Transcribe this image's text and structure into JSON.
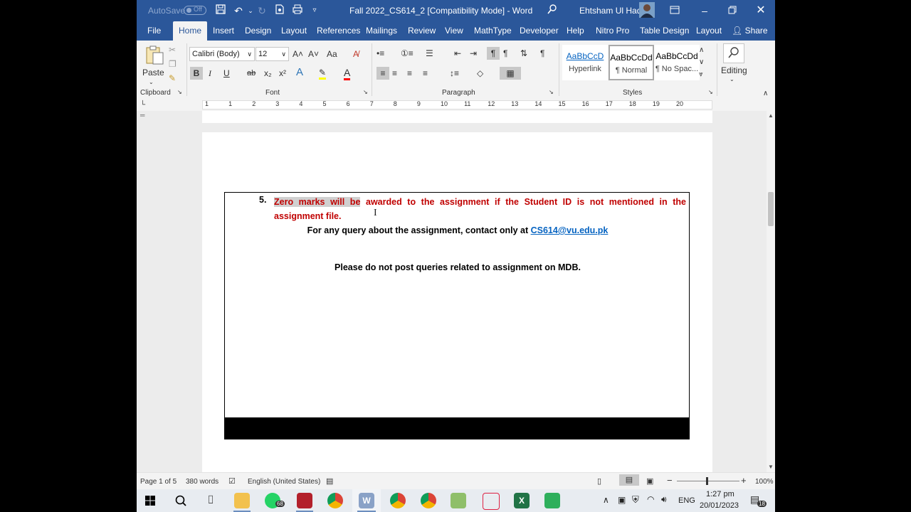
{
  "window": {
    "autosave_label": "AutoSave",
    "autosave_state": "Off",
    "doc_title": "Fall 2022_CS614_2 [Compatibility Mode]  -  Word",
    "user_name": "Ehtsham Ul Haq"
  },
  "tabs": [
    "File",
    "Home",
    "Insert",
    "Design",
    "Layout",
    "References",
    "Mailings",
    "Review",
    "View",
    "MathType",
    "Developer",
    "Help",
    "Nitro Pro",
    "Table Design",
    "Layout"
  ],
  "share_label": "Share",
  "ribbon": {
    "clipboard": {
      "paste_label": "Paste",
      "group_label": "Clipboard"
    },
    "font": {
      "name": "Calibri (Body)",
      "size": "12",
      "group_label": "Font",
      "bold": "B",
      "italic": "I",
      "underline": "U",
      "strike": "ab",
      "sub": "x₂",
      "sup": "x²",
      "case": "Aa"
    },
    "paragraph": {
      "group_label": "Paragraph"
    },
    "styles": {
      "group_label": "Styles",
      "items": [
        {
          "preview": "AaBbCcD",
          "name": "Hyperlink"
        },
        {
          "preview": "AaBbCcDd",
          "name": "¶ Normal"
        },
        {
          "preview": "AaBbCcDd",
          "name": "¶ No Spac..."
        }
      ]
    },
    "editing": {
      "label": "Editing"
    }
  },
  "ruler": {
    "numbers": [
      "1",
      "1",
      "2",
      "3",
      "4",
      "5",
      "6",
      "7",
      "8",
      "9",
      "10",
      "11",
      "12",
      "13",
      "14",
      "15",
      "16",
      "17",
      "18",
      "19",
      "20"
    ]
  },
  "document": {
    "item_number": "5.",
    "item_highlight": "Zero marks will be",
    "item_rest_line1": " awarded to the assignment if the Student ID is not mentioned in the",
    "item_line2": "assignment file.",
    "contact_text": "For any query about the assignment, contact only at ",
    "contact_email": "CS614@vu.edu.pk",
    "mdb_text": "Please do not post queries related to assignment on MDB."
  },
  "status": {
    "page": "Page 1 of 5",
    "words": "380 words",
    "language": "English (United States)",
    "zoom": "100%"
  },
  "taskbar": {
    "whatsapp_badge": "68",
    "tray_lang": "ENG",
    "time": "1:27 pm",
    "date": "20/01/2023",
    "notif_count": "18"
  },
  "colors": {
    "word_blue": "#2b579a",
    "red_text": "#c00000",
    "link": "#0563c1"
  }
}
